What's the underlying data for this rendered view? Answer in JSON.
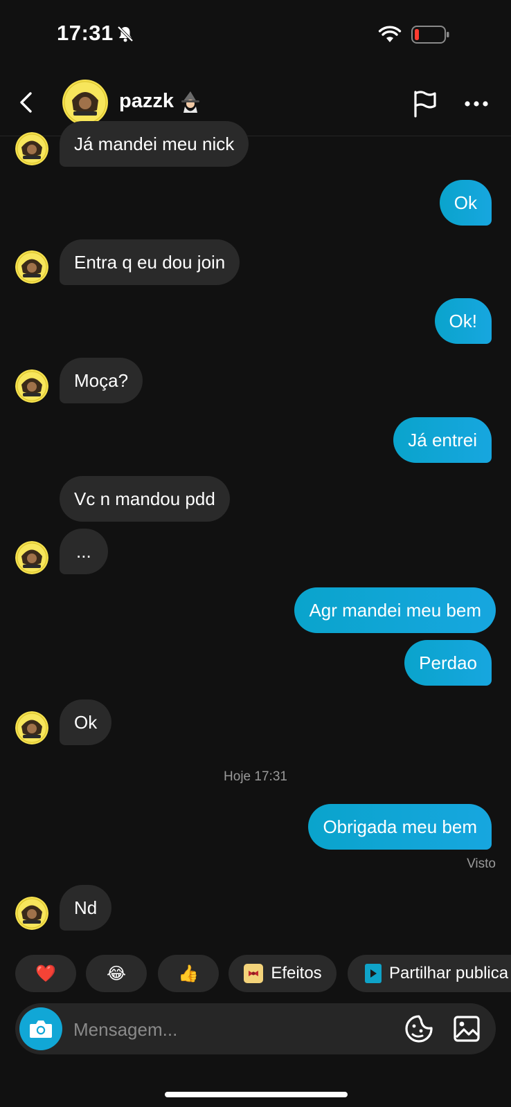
{
  "status_bar": {
    "time": "17:31"
  },
  "header": {
    "contact_name": "pazzk"
  },
  "messages": [
    {
      "side": "in",
      "text": "Já mandei meu nick"
    },
    {
      "side": "out",
      "text": "Ok"
    },
    {
      "side": "in",
      "text": "Entra q eu dou join"
    },
    {
      "side": "out",
      "text": "Ok!"
    },
    {
      "side": "in",
      "text": "Moça?"
    },
    {
      "side": "out",
      "text": "Já entrei"
    },
    {
      "side": "in",
      "text": "Vc n mandou pdd"
    },
    {
      "side": "in",
      "text": "..."
    },
    {
      "side": "out",
      "text": "Agr mandei meu bem"
    },
    {
      "side": "out",
      "text": "Perdao"
    },
    {
      "side": "in",
      "text": "Ok"
    },
    {
      "side": "out",
      "text": "Obrigada meu bem"
    },
    {
      "side": "in",
      "text": "Nd"
    }
  ],
  "timestamp": "Hoje 17:31",
  "seen_label": "Visto",
  "quick_actions": {
    "reactions": [
      "❤️",
      "😂",
      "👍"
    ],
    "effects_label": "Efeitos",
    "share_label": "Partilhar publica"
  },
  "composer": {
    "placeholder": "Mensagem..."
  },
  "colors": {
    "background": "#111111",
    "incoming_bubble": "#2a2a2a",
    "outgoing_bubble": "#13a6d8",
    "camera_button": "#11a7d6"
  },
  "icons": [
    "bell-off-icon",
    "wifi-icon",
    "battery-low-icon",
    "back-chevron-icon",
    "flag-icon",
    "more-icon",
    "camera-icon",
    "sticker-icon",
    "gallery-icon"
  ]
}
